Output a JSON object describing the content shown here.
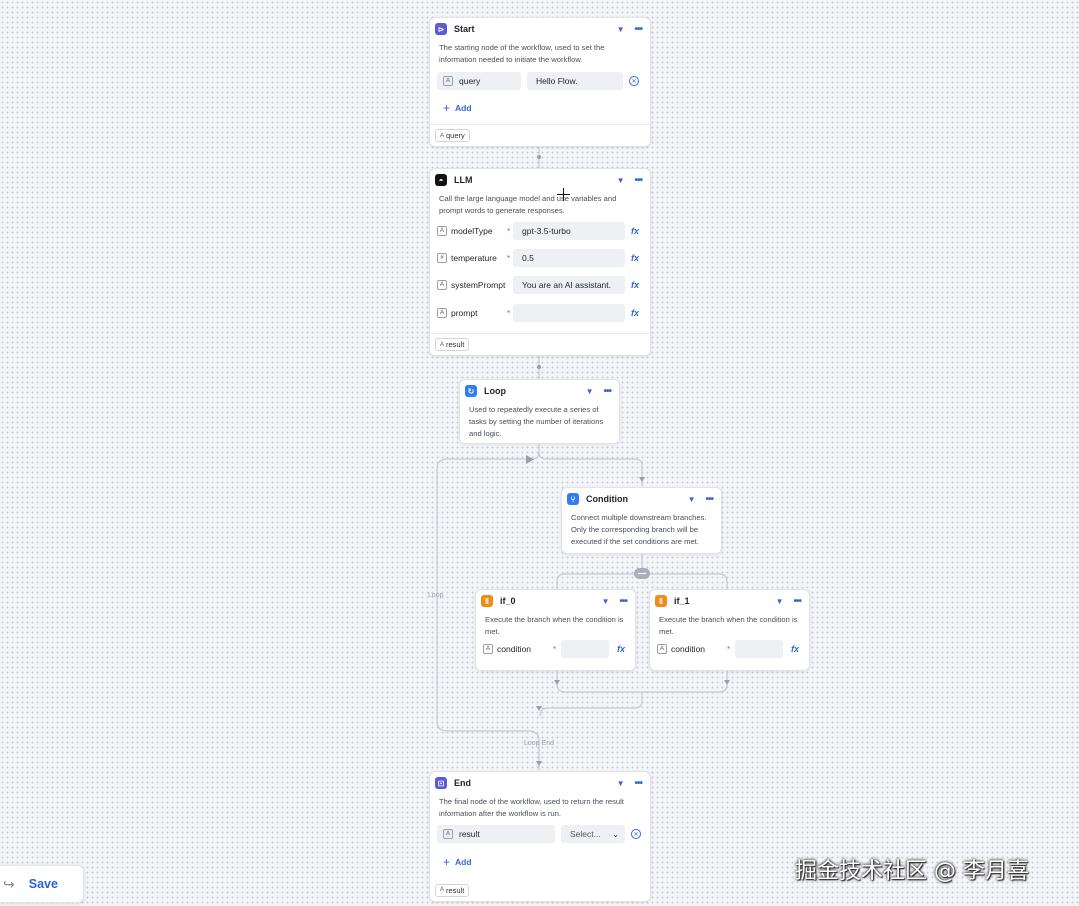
{
  "start": {
    "title": "Start",
    "desc": "The starting node of the workflow, used to set the information needed to initiate the workflow.",
    "field_name": "query",
    "field_value": "Hello Flow.",
    "add_label": "Add",
    "output": "query"
  },
  "llm": {
    "title": "LLM",
    "desc": "Call the large language model and use variables and prompt words to generate responses.",
    "params": [
      {
        "name": "modelType",
        "value": "gpt-3.5-turbo"
      },
      {
        "name": "temperature",
        "value": "0.5"
      },
      {
        "name": "systemPrompt",
        "value": "You are an AI assistant."
      },
      {
        "name": "prompt",
        "value": ""
      }
    ],
    "output": "result"
  },
  "loop": {
    "title": "Loop",
    "desc": "Used to repeatedly execute a series of tasks by setting the number of iterations and logic.",
    "side_label": "Loop",
    "bottom_label": "Loop End"
  },
  "condition": {
    "title": "Condition",
    "desc": "Connect multiple downstream branches. Only the corresponding branch will be executed if the set conditions are met."
  },
  "if0": {
    "title": "if_0",
    "desc": "Execute the branch when the condition is met.",
    "param": "condition"
  },
  "if1": {
    "title": "if_1",
    "desc": "Execute the branch when the condition is met.",
    "param": "condition"
  },
  "end": {
    "title": "End",
    "desc": "The final node of the workflow, used to return the result information after the workflow is run.",
    "field_name": "result",
    "select_placeholder": "Select...",
    "add_label": "Add",
    "output": "result"
  },
  "save_label": "Save",
  "watermark": "掘金技术社区 @ 李月喜",
  "colors": {
    "accent": "#3366dd",
    "start_icon": "#5b5bd6",
    "llm_icon": "#111111",
    "loop_icon": "#2f7ef5",
    "condition_icon": "#2f7ef5",
    "branch_icon": "#f08c1a",
    "end_icon": "#5b5bd6"
  }
}
